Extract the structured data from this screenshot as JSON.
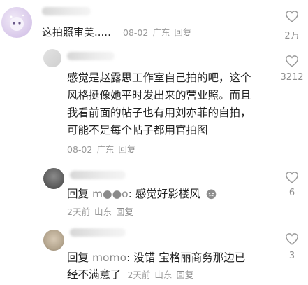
{
  "comments": [
    {
      "text": "这拍照审美.....",
      "date": "08-02",
      "location": "广东",
      "reply_label": "回复",
      "likes": "2万"
    },
    {
      "lines": [
        "感觉是赵露思工作室自己拍的吧，这个",
        "风格挺像她平时发出来的营业照。而且",
        "我看前面的帖子也有用刘亦菲的自拍，",
        "可能不是每个帖子都用官拍图"
      ],
      "date": "08-02",
      "location": "广东",
      "reply_label": "回复",
      "likes": "3212"
    },
    {
      "reply_prefix": "回复",
      "at_user": "m●●o",
      "text": ": 感觉好影楼风",
      "time": "2天前",
      "location": "山东",
      "reply_label": "回复",
      "likes": "6"
    },
    {
      "reply_prefix": "回复",
      "at_user": "momo",
      "line1": ": 没错  宝格丽商务那边已",
      "line2": "经不满意了",
      "time": "2天前",
      "location": "山东",
      "reply_label": "回复",
      "likes": "3"
    }
  ]
}
